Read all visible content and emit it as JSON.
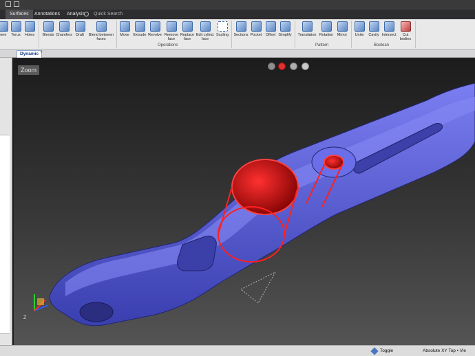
{
  "tabs": {
    "surfaces": "Surfaces",
    "annotations": "Annotations",
    "analysis": "Analysis",
    "quick_search": "Quick Search"
  },
  "ribbon": {
    "items": [
      {
        "label": "here",
        "icon": "sphere-icon"
      },
      {
        "label": "Torus",
        "icon": "torus-icon"
      },
      {
        "label": "Holes",
        "icon": "holes-icon"
      },
      {
        "label": "Blends",
        "icon": "blends-icon"
      },
      {
        "label": "Chamfers",
        "icon": "chamfers-icon"
      },
      {
        "label": "Draft",
        "icon": "draft-icon"
      },
      {
        "label": "Blend between faces",
        "icon": "blend-faces-icon"
      },
      {
        "label": "Move",
        "icon": "move-icon"
      },
      {
        "label": "Extrude",
        "icon": "extrude-icon"
      },
      {
        "label": "Revolve",
        "icon": "revolve-icon"
      },
      {
        "label": "Remove face",
        "icon": "remove-face-icon"
      },
      {
        "label": "Replace face",
        "icon": "replace-face-icon"
      },
      {
        "label": "Edit cylind. face",
        "icon": "edit-cylinder-icon"
      },
      {
        "label": "Scaling",
        "icon": "scaling-icon"
      },
      {
        "label": "Sections",
        "icon": "sections-icon"
      },
      {
        "label": "Pocket",
        "icon": "pocket-icon"
      },
      {
        "label": "Offset",
        "icon": "offset-icon"
      },
      {
        "label": "Simplify",
        "icon": "simplify-icon"
      },
      {
        "label": "Translation",
        "icon": "translation-icon"
      },
      {
        "label": "Rotation",
        "icon": "rotation-icon"
      },
      {
        "label": "Mirror",
        "icon": "mirror-icon"
      },
      {
        "label": "Unite",
        "icon": "unite-icon"
      },
      {
        "label": "Cavity",
        "icon": "cavity-icon"
      },
      {
        "label": "Intersect",
        "icon": "intersect-icon"
      },
      {
        "label": "Cut bodies",
        "icon": "cut-bodies-icon"
      }
    ],
    "groups": {
      "operations": "Operations",
      "pattern": "Pattern",
      "boolean": "Boolean"
    }
  },
  "document": {
    "tab_label": "Dynamic",
    "add_tab": "+"
  },
  "viewport": {
    "zoom_label": "Zoom",
    "buttons": [
      "confirm-icon",
      "cancel-icon",
      "settings-icon",
      "help-icon"
    ],
    "model_color": "#5a5fd6",
    "highlight_color": "#ff1010",
    "axes": {
      "x": "X",
      "y": "Y",
      "z": "Z"
    }
  },
  "status": {
    "toggle": "Toggle",
    "coords": "Absolute XY Top  •  Vie"
  }
}
